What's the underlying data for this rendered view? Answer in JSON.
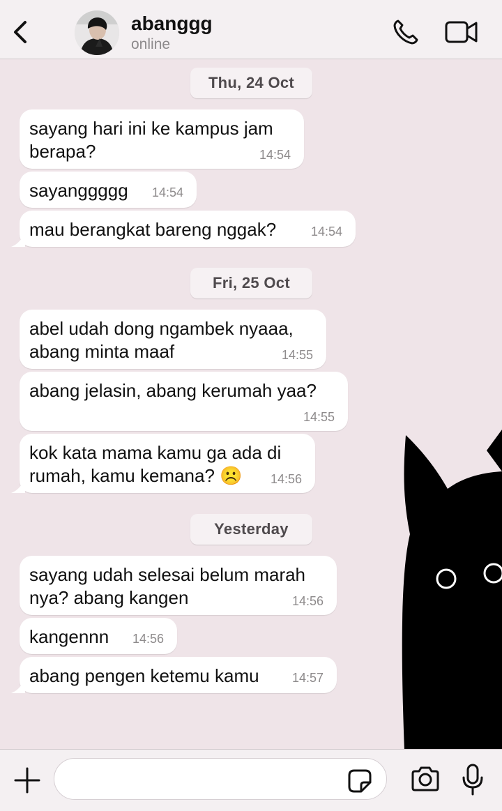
{
  "header": {
    "contact_name": "abanggg",
    "status": "online",
    "icons": [
      "chevron-left-icon",
      "phone-icon",
      "video-camera-icon"
    ]
  },
  "chat": {
    "groups": [
      {
        "date": "Thu, 24 Oct",
        "messages": [
          {
            "text": "sayang hari ini ke kampus jam berapa?",
            "time": "14:54"
          },
          {
            "text": "sayanggggg",
            "time": "14:54"
          },
          {
            "text": "mau berangkat bareng nggak?",
            "time": "14:54"
          }
        ]
      },
      {
        "date": "Fri, 25 Oct",
        "messages": [
          {
            "text": "abel udah dong ngambek nyaaa, abang minta maaf",
            "time": "14:55"
          },
          {
            "text": "abang jelasin, abang kerumah yaa?",
            "time": "14:55"
          },
          {
            "text": "kok kata mama kamu ga ada di rumah, kamu kemana? ☹️",
            "time": "14:56"
          }
        ]
      },
      {
        "date": "Yesterday",
        "messages": [
          {
            "text": "sayang udah selesai belum marah nya? abang kangen",
            "time": "14:56"
          },
          {
            "text": "kangennn",
            "time": "14:56"
          },
          {
            "text": "abang pengen ketemu kamu",
            "time": "14:57"
          }
        ]
      }
    ]
  },
  "composer": {
    "input_value": "",
    "icons": [
      "plus-icon",
      "sticker-icon",
      "camera-icon",
      "microphone-icon"
    ]
  },
  "colors": {
    "chat_background": "#efe4e8",
    "bubble": "#ffffff",
    "header_background": "#f4f0f2",
    "cat": "#000000"
  }
}
